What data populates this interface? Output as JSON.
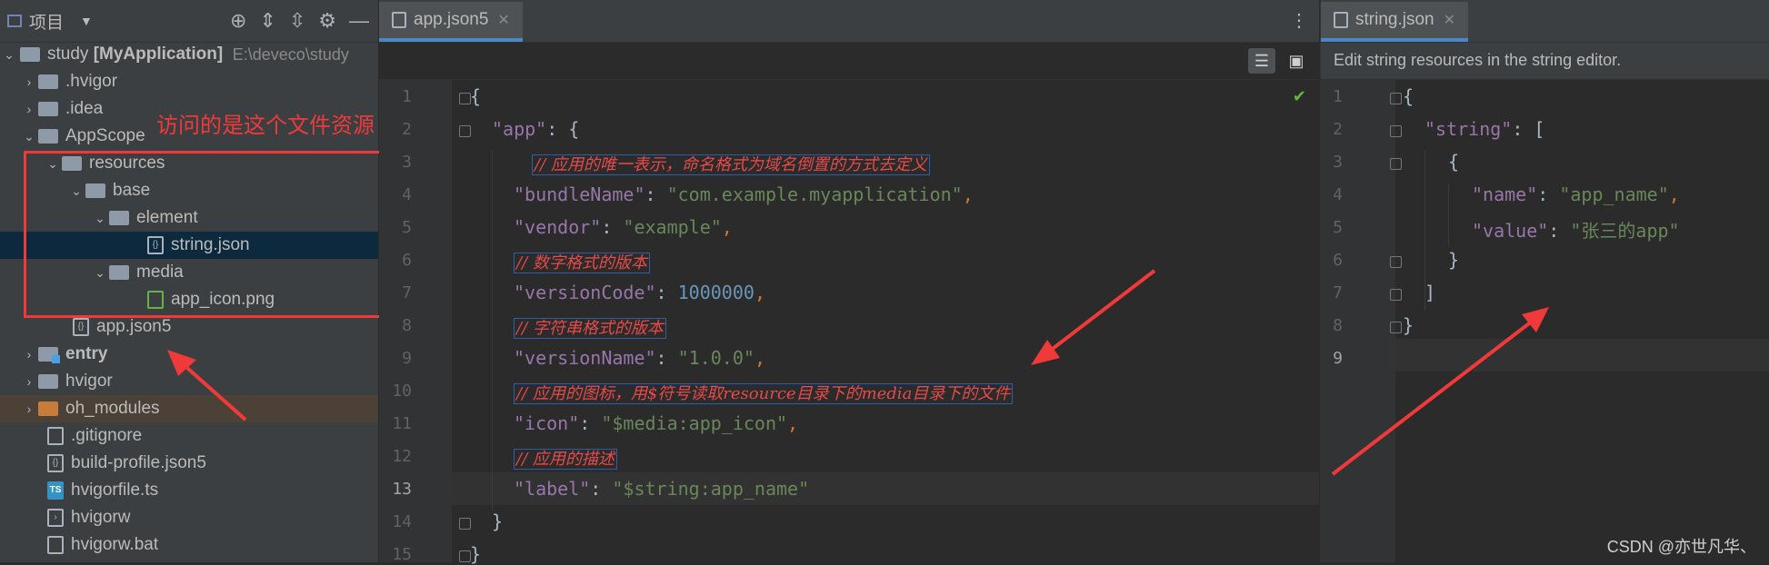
{
  "project_panel": {
    "title": "项目",
    "root": {
      "name": "study",
      "module": "[MyApplication]",
      "path": "E:\\deveco\\study"
    },
    "tree": [
      {
        "label": ".hvigor"
      },
      {
        "label": ".idea"
      },
      {
        "label": "AppScope"
      },
      {
        "label": "resources"
      },
      {
        "label": "base"
      },
      {
        "label": "element"
      },
      {
        "label": "string.json"
      },
      {
        "label": "media"
      },
      {
        "label": "app_icon.png"
      },
      {
        "label": "app.json5"
      },
      {
        "label": "entry"
      },
      {
        "label": "hvigor"
      },
      {
        "label": "oh_modules"
      },
      {
        "label": ".gitignore"
      },
      {
        "label": "build-profile.json5"
      },
      {
        "label": "hvigorfile.ts"
      },
      {
        "label": "hvigorw"
      },
      {
        "label": "hvigorw.bat"
      }
    ]
  },
  "annotation": "访问的是这个文件资源",
  "editor_left": {
    "tab": "app.json5",
    "line_numbers": [
      "1",
      "2",
      "3",
      "4",
      "5",
      "6",
      "7",
      "8",
      "9",
      "10",
      "11",
      "12",
      "13",
      "14",
      "15"
    ],
    "lines": {
      "l1": "{",
      "l2_key": "\"app\"",
      "l2_rest": ": {",
      "l3": "// 应用的唯一表示，命名格式为域名倒置的方式去定义",
      "l4_key": "\"bundleName\"",
      "l4_val": "\"com.example.myapplication\"",
      "l5_key": "\"vendor\"",
      "l5_val": "\"example\"",
      "l6": "// 数字格式的版本",
      "l7_key": "\"versionCode\"",
      "l7_val": "1000000",
      "l8": "// 字符串格式的版本",
      "l9_key": "\"versionName\"",
      "l9_val": "\"1.0.0\"",
      "l10": "// 应用的图标，用$符号读取resource目录下的media目录下的文件",
      "l11_key": "\"icon\"",
      "l11_val": "\"$media:app_icon\"",
      "l12": "// 应用的描述",
      "l13_key": "\"label\"",
      "l13_val": "\"$string:app_name\"",
      "l14": "}",
      "l15": "}"
    }
  },
  "editor_right": {
    "tab": "string.json",
    "banner": "Edit string resources in the string editor.",
    "line_numbers": [
      "1",
      "2",
      "3",
      "4",
      "5",
      "6",
      "7",
      "8",
      "9"
    ],
    "lines": {
      "l1": "{",
      "l2_key": "\"string\"",
      "l2_rest": ": [",
      "l3": "{",
      "l4_key": "\"name\"",
      "l4_val": "\"app_name\"",
      "l5_key": "\"value\"",
      "l5_val": "\"张三的app\"",
      "l6": "}",
      "l7": "]",
      "l8": "}"
    }
  },
  "watermark": "CSDN @亦世凡华、",
  "colors": {
    "annotation_red": "#f03a3a",
    "selection": "#0d293e",
    "tab_accent": "#4a88c7"
  }
}
